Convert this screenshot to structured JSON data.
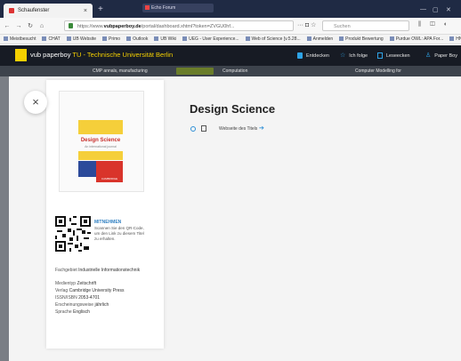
{
  "browser": {
    "active_tab": "Schaufenster",
    "other_tab": "Echo Forum",
    "url_prefix": "https://www.",
    "url_domain": "vubpaperboy.de",
    "url_rest": "/portal/dashboard.xhtml?token=ZVGU0hf...",
    "url_actions": "··· ◘ ☆",
    "search_placeholder": "Suchen",
    "toolbar_icons": "⫼ ◫ ◐",
    "bookmarks": [
      "Meistbesucht",
      "CHAT",
      "UB Website",
      "Primo",
      "Outlook",
      "UB Wiki",
      "UEG - User Experience...",
      "Web of Science [v.5.28...",
      "Anmelden",
      "Produkt Bewertung",
      "Purdue OWL: APA For...",
      "HN"
    ]
  },
  "app": {
    "brand": "vub paperboy",
    "brand_suffix": "TU - Technische Universität Berlin",
    "nav": [
      "Entdecken",
      "Ich folge",
      "Leseecken",
      "Paper Boy"
    ],
    "strip": [
      "CMP annals, manufacturing",
      "Computation",
      "Computer Modelling for"
    ]
  },
  "detail": {
    "close_symbol": "×",
    "cover_title": "Design Science",
    "cover_subtitle": "An international journal",
    "cover_publisher": "CAMBRIDGE",
    "title": "Design Science",
    "website_link": "Webseite des Titels",
    "arrow": "➔",
    "qr": {
      "heading": "MITNEHMEN",
      "text": "Scannen Sie den QR-Code, um den Link zu diesem Titel zu erhalten."
    },
    "meta": [
      {
        "label": "Fachgebiet",
        "value": "Industrielle Informationstechnik"
      },
      {
        "label": "Medientyp",
        "value": "Zeitschrift"
      },
      {
        "label": "Verlag",
        "value": "Cambridge University Press"
      },
      {
        "label": "ISSN/ISBN",
        "value": "2053-4701"
      },
      {
        "label": "Erscheinungsweise",
        "value": "jährlich"
      },
      {
        "label": "Sprache",
        "value": "Englisch"
      }
    ]
  },
  "colors": {
    "header_bg": "#171b24",
    "brand_yellow": "#f5d000",
    "link_blue": "#2f7fc1",
    "accent_blue": "#2ea3e6"
  }
}
